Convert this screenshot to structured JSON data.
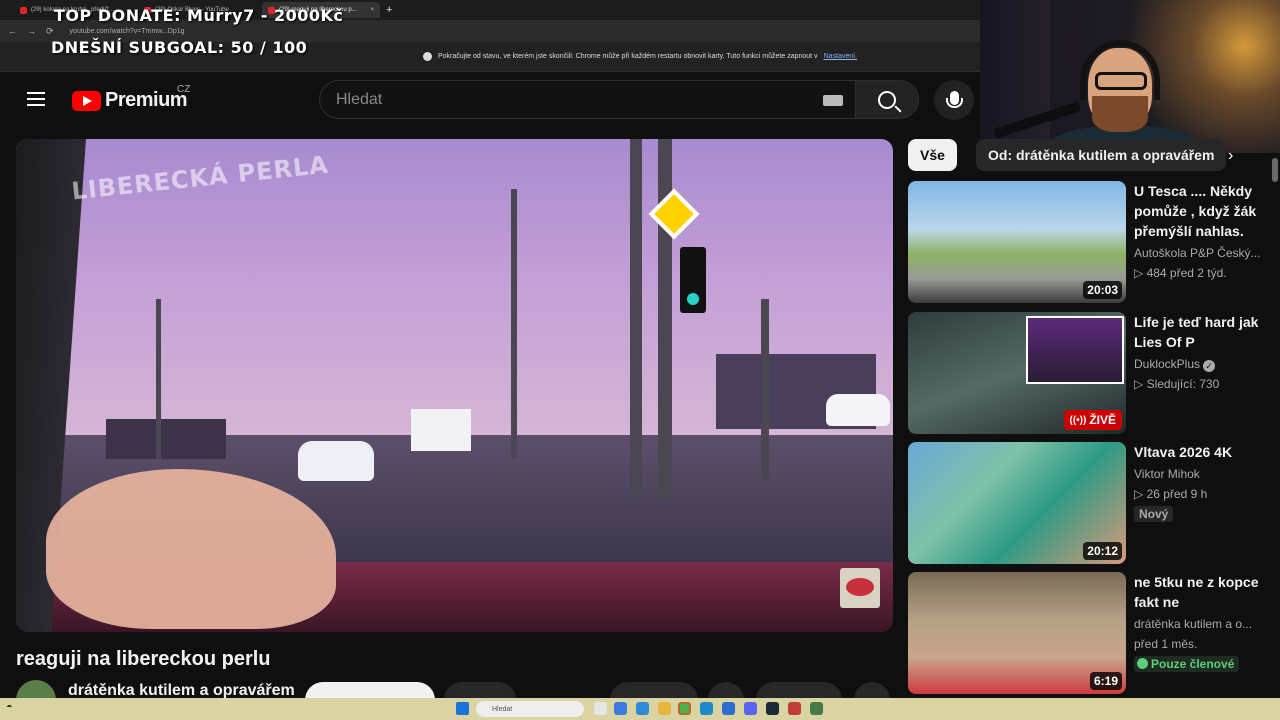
{
  "browser": {
    "tabs": [
      {
        "label": "(29) kolona na kruhá...předjíž..."
      },
      {
        "label": "(29) Oskar Blues - YouTube"
      },
      {
        "label": "(29) reaguji na libereckou p..."
      }
    ],
    "url": "youtube.com/watch?v=Tmmw...Dp1g",
    "infobar_text": "Pokračujte od stavu, ve kterém jste skončili: Chrome může při každém restartu obnovit karty. Tuto funkci můžete zapnout v",
    "infobar_link": "Nastavení."
  },
  "overlay": {
    "top_donate": "TOP DONATE: Murry7 - 2000Kč",
    "subgoal": "DNEŠNÍ SUBGOAL:  50 / 100"
  },
  "header": {
    "brand": "Premium",
    "country": "CZ",
    "search_placeholder": "Hledat"
  },
  "video": {
    "watermark": "LIBERECKÁ PERLA",
    "title": "reaguji na libereckou perlu",
    "channel": "drátěnka kutilem a opravářem"
  },
  "chips": [
    {
      "label": "Vše"
    },
    {
      "label": "Od: drátěnka kutilem a opravářem"
    }
  ],
  "recommendations": [
    {
      "title": "U Tesca .... Někdy pomůže , když  žák přemýšlí nahlas.",
      "channel": "Autoškola P&P Český...",
      "stats": "484  před 2 týd.",
      "duration": "20:03"
    },
    {
      "title": "Life je teď hard jak Lies Of P",
      "channel": "DuklockPlus",
      "stats": "Sledující: 730",
      "live_label": "ŽIVĚ"
    },
    {
      "title": "Vltava 2026 4K",
      "channel": "Viktor Mihok",
      "stats": "26  před 9 h",
      "badge": "Nový",
      "duration": "20:12"
    },
    {
      "title": "ne 5tku ne z kopce fakt ne",
      "channel": "drátěnka kutilem a o...",
      "stats": "před 1 měs.",
      "badge": "Pouze členové",
      "duration": "6:19"
    }
  ],
  "taskbar": {
    "search_placeholder": "Hledat"
  }
}
